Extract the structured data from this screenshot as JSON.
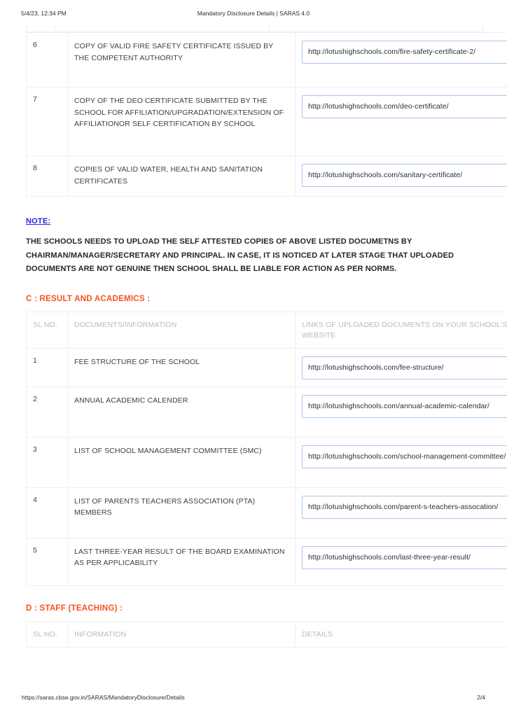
{
  "print_header": {
    "timestamp": "5/4/23, 12:34 PM",
    "doc_title": "Mandatory Disclosure Details | SARAS 4.0"
  },
  "colors": {
    "section_heading": "#f9501e",
    "note_label": "#2727e6",
    "url_box_border": "#a7c7ef",
    "table_border": "#eceff1",
    "header_text": "#b4bcc2",
    "body_text": "#3c4043"
  },
  "section_b_continued": {
    "rows": [
      {
        "sl": "6",
        "document": "COPY OF VALID FIRE SAFETY CERTIFICATE ISSUED BY THE COMPETENT AUTHORITY",
        "url": "http://lotushighschools.com/fire-safety-certificate-2/"
      },
      {
        "sl": "7",
        "document": "COPY OF THE DEO CERTIFICATE SUBMITTED BY THE SCHOOL FOR AFFILIATION/UPGRADATION/EXTENSION OF AFFILIATIONOR SELF CERTIFICATION BY SCHOOL",
        "url": "http://lotushighschools.com/deo-certificate/"
      },
      {
        "sl": "8",
        "document": "COPIES OF VALID WATER, HEALTH AND SANITATION CERTIFICATES",
        "url": "http://lotushighschools.com/sanitary-certificate/"
      }
    ]
  },
  "note": {
    "label": "NOTE:",
    "body": "THE SCHOOLS NEEDS TO UPLOAD THE SELF ATTESTED COPIES OF ABOVE LISTED DOCUMETNS BY CHAIRMAN/MANAGER/SECRETARY AND PRINCIPAL. IN CASE, IT IS NOTICED AT LATER STAGE THAT UPLOADED DOCUMENTS ARE NOT GENUINE THEN SCHOOL SHALL BE LIABLE FOR ACTION AS PER NORMS."
  },
  "section_c": {
    "title": "C : RESULT AND ACADEMICS :",
    "headers": {
      "sl": "SL NO.",
      "document": "DOCUMENTS/INFORMATION",
      "link": "LINKS OF UPLOADED DOCUMENTS ON YOUR SCHOOL'S WEBSITE"
    },
    "rows": [
      {
        "sl": "1",
        "document": "FEE STRUCTURE OF THE SCHOOL",
        "url": "http://lotushighschools.com/fee-structure/"
      },
      {
        "sl": "2",
        "document": "ANNUAL ACADEMIC CALENDER",
        "url": "http://lotushighschools.com/annual-academic-calendar/"
      },
      {
        "sl": "3",
        "document": "LIST OF SCHOOL MANAGEMENT COMMITTEE (SMC)",
        "url": "http://lotushighschools.com/school-management-committee/"
      },
      {
        "sl": "4",
        "document": "LIST OF PARENTS TEACHERS ASSOCIATION (PTA) MEMBERS",
        "url": "http://lotushighschools.com/parent-s-teachers-assocation/"
      },
      {
        "sl": "5",
        "document": "LAST THREE-YEAR RESULT OF THE BOARD EXAMINATION AS PER APPLICABILITY",
        "url": "http://lotushighschools.com/last-three-year-result/"
      }
    ]
  },
  "section_d": {
    "title": "D : STAFF (TEACHING) :",
    "headers": {
      "sl": "SL NO.",
      "information": "INFORMATION",
      "details": "DETAILS"
    },
    "rows": []
  },
  "print_footer": {
    "url": "https://saras.cbse.gov.in/SARAS/MandatoryDisclosure/Details",
    "page": "2/4"
  }
}
